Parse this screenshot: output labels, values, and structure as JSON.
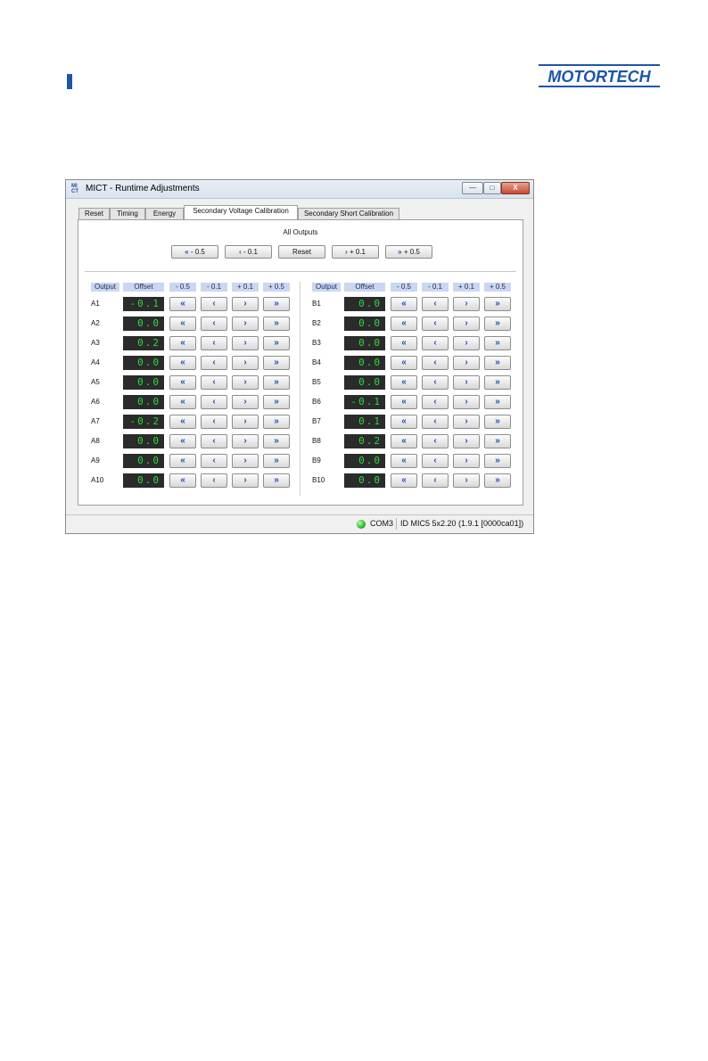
{
  "brand": {
    "logo_text": "MOTORTECH",
    "accent": "#1e55a8"
  },
  "window": {
    "icon_text": "MI CT",
    "title": "MICT - Runtime Adjustments",
    "buttons": {
      "minimize": "—",
      "maximize": "□",
      "close": "X"
    }
  },
  "tabs": [
    {
      "label": "Reset"
    },
    {
      "label": "Timing"
    },
    {
      "label": "Energy"
    },
    {
      "label": "Secondary Voltage Calibration",
      "active": true
    },
    {
      "label": "Secondary Short Calibration"
    }
  ],
  "all_outputs": {
    "title": "All Outputs",
    "buttons": [
      {
        "icon": "double-chevron-left-icon",
        "label": "- 0.5"
      },
      {
        "icon": "chevron-left-icon",
        "label": "- 0.1"
      },
      {
        "icon": "",
        "label": "Reset"
      },
      {
        "icon": "chevron-right-icon",
        "label": "+ 0.1"
      },
      {
        "icon": "double-chevron-right-icon",
        "label": "+ 0.5"
      }
    ]
  },
  "columns": {
    "output": "Output",
    "offset": "Offset",
    "minus_05": "- 0.5",
    "minus_01": "- 0.1",
    "plus_01": "+ 0.1",
    "plus_05": "+ 0.5"
  },
  "left_rows": [
    {
      "label": "A1",
      "offset": "-0.1"
    },
    {
      "label": "A2",
      "offset": "0.0"
    },
    {
      "label": "A3",
      "offset": "0.2"
    },
    {
      "label": "A4",
      "offset": "0.0"
    },
    {
      "label": "A5",
      "offset": "0.0"
    },
    {
      "label": "A6",
      "offset": "0.0"
    },
    {
      "label": "A7",
      "offset": "-0.2"
    },
    {
      "label": "A8",
      "offset": "0.0"
    },
    {
      "label": "A9",
      "offset": "0.0"
    },
    {
      "label": "A10",
      "offset": "0.0"
    }
  ],
  "right_rows": [
    {
      "label": "B1",
      "offset": "0.0"
    },
    {
      "label": "B2",
      "offset": "0.0"
    },
    {
      "label": "B3",
      "offset": "0.0"
    },
    {
      "label": "B4",
      "offset": "0.0"
    },
    {
      "label": "B5",
      "offset": "0.0"
    },
    {
      "label": "B6",
      "offset": "-0.1"
    },
    {
      "label": "B7",
      "offset": "0.1"
    },
    {
      "label": "B8",
      "offset": "0.2"
    },
    {
      "label": "B9",
      "offset": "0.0"
    },
    {
      "label": "B10",
      "offset": "0.0"
    }
  ],
  "status": {
    "port": "COM3",
    "device": "ID MIC5 5x2.20 (1.9.1 [0000ca01])",
    "led_color": "#2fb52a"
  }
}
